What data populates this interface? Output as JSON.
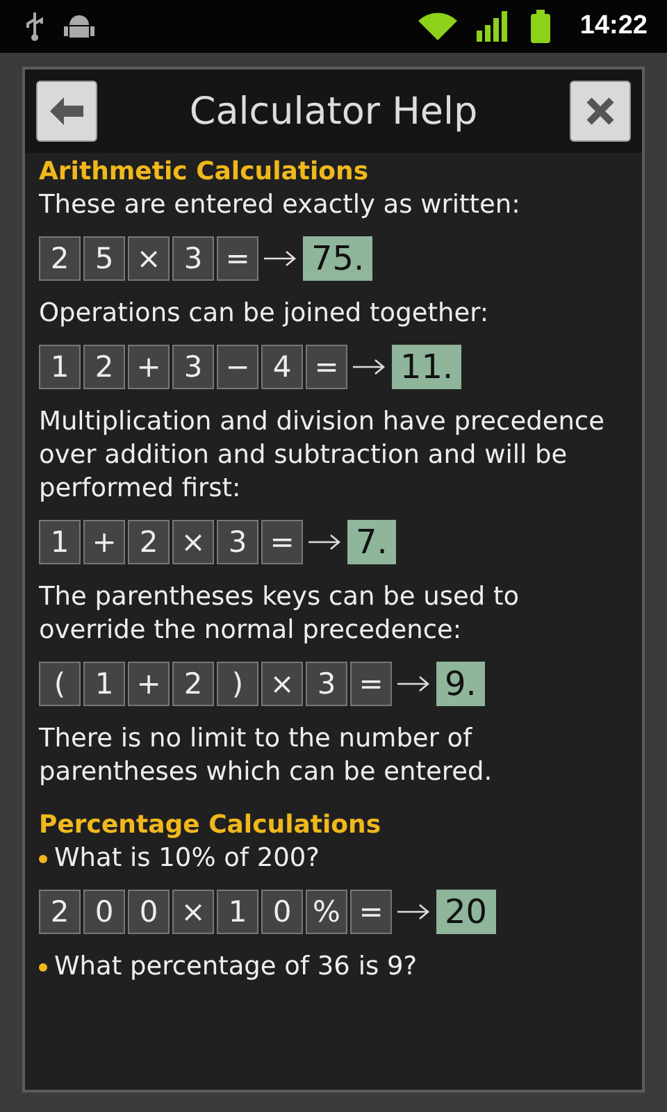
{
  "status_bar": {
    "time": "14:22"
  },
  "dialog": {
    "title": "Calculator Help"
  },
  "sections": [
    {
      "heading": "Arithmetic Calculations",
      "blocks": [
        {
          "kind": "text",
          "text": "These are entered exactly as written:"
        },
        {
          "kind": "keys",
          "keys": [
            "2",
            "5",
            "×",
            "3",
            "="
          ],
          "result": "75."
        },
        {
          "kind": "text",
          "text": "Operations can be joined together:"
        },
        {
          "kind": "keys",
          "keys": [
            "1",
            "2",
            "+",
            "3",
            "−",
            "4",
            "="
          ],
          "result": "11."
        },
        {
          "kind": "text",
          "text": "Multiplication and division have precedence over addition and subtraction and will be performed first:"
        },
        {
          "kind": "keys",
          "keys": [
            "1",
            "+",
            "2",
            "×",
            "3",
            "="
          ],
          "result": "7."
        },
        {
          "kind": "text",
          "text": "The parentheses keys can be used to override the normal precedence:"
        },
        {
          "kind": "keys",
          "keys": [
            "(",
            "1",
            "+",
            "2",
            ")",
            "×",
            "3",
            "="
          ],
          "result": "9."
        },
        {
          "kind": "text",
          "text": "There is no limit to the number of parentheses which can be entered."
        }
      ]
    },
    {
      "heading": "Percentage Calculations",
      "blocks": [
        {
          "kind": "bullet",
          "text": "What is 10% of 200?"
        },
        {
          "kind": "keys",
          "keys": [
            "2",
            "0",
            "0",
            "×",
            "1",
            "0",
            "%",
            "="
          ],
          "result": "20"
        },
        {
          "kind": "bullet",
          "text": "What percentage of 36 is 9?"
        }
      ]
    }
  ]
}
